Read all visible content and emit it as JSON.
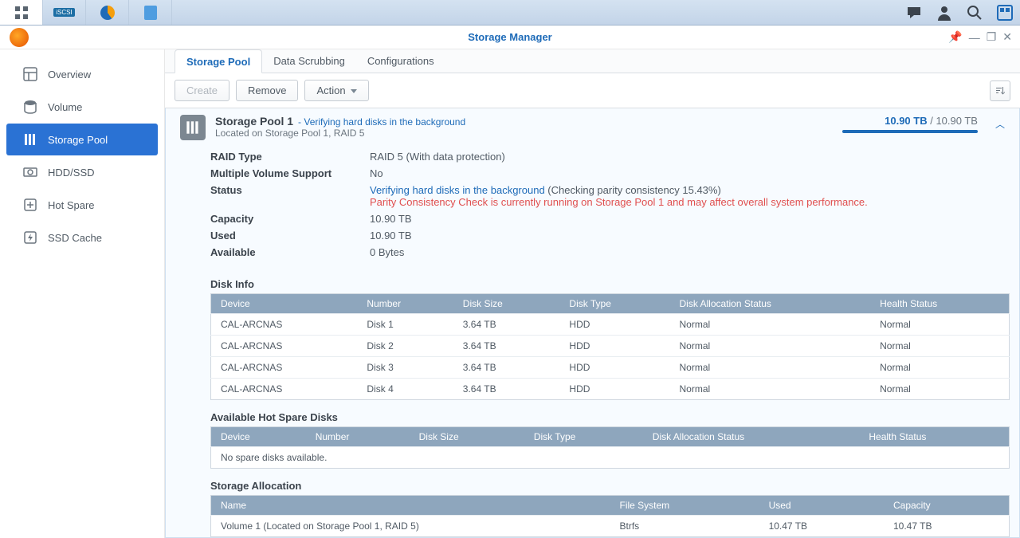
{
  "window": {
    "title": "Storage Manager"
  },
  "sidebar": {
    "items": [
      {
        "label": "Overview"
      },
      {
        "label": "Volume"
      },
      {
        "label": "Storage Pool"
      },
      {
        "label": "HDD/SSD"
      },
      {
        "label": "Hot Spare"
      },
      {
        "label": "SSD Cache"
      }
    ]
  },
  "tabs": {
    "items": [
      {
        "label": "Storage Pool"
      },
      {
        "label": "Data Scrubbing"
      },
      {
        "label": "Configurations"
      }
    ]
  },
  "toolbar": {
    "create": "Create",
    "remove": "Remove",
    "action": "Action"
  },
  "pool": {
    "name": "Storage Pool 1",
    "status_inline": "- Verifying hard disks in the background",
    "location": "Located on Storage Pool 1, RAID 5",
    "capacity_used": "10.90 TB",
    "capacity_total": "10.90 TB",
    "capacity_sep": " / ",
    "fields": {
      "raid_type_label": "RAID Type",
      "raid_type_value": "RAID 5 (With data protection)",
      "mv_label": "Multiple Volume Support",
      "mv_value": "No",
      "status_label": "Status",
      "status_value": "Verifying hard disks in the background",
      "status_extra": " (Checking parity consistency 15.43%)",
      "status_warn": "Parity Consistency Check is currently running on Storage Pool 1 and may affect overall system performance.",
      "capacity_label": "Capacity",
      "capacity_value": "10.90 TB",
      "used_label": "Used",
      "used_value": "10.90 TB",
      "avail_label": "Available",
      "avail_value": "0 Bytes"
    }
  },
  "disk_info": {
    "title": "Disk Info",
    "cols": [
      "Device",
      "Number",
      "Disk Size",
      "Disk Type",
      "Disk Allocation Status",
      "Health Status"
    ],
    "rows": [
      {
        "device": "CAL-ARCNAS",
        "number": "Disk 1",
        "size": "3.64 TB",
        "type": "HDD",
        "alloc": "Normal",
        "health": "Normal"
      },
      {
        "device": "CAL-ARCNAS",
        "number": "Disk 2",
        "size": "3.64 TB",
        "type": "HDD",
        "alloc": "Normal",
        "health": "Normal"
      },
      {
        "device": "CAL-ARCNAS",
        "number": "Disk 3",
        "size": "3.64 TB",
        "type": "HDD",
        "alloc": "Normal",
        "health": "Normal"
      },
      {
        "device": "CAL-ARCNAS",
        "number": "Disk 4",
        "size": "3.64 TB",
        "type": "HDD",
        "alloc": "Normal",
        "health": "Normal"
      }
    ]
  },
  "hotspare": {
    "title": "Available Hot Spare Disks",
    "cols": [
      "Device",
      "Number",
      "Disk Size",
      "Disk Type",
      "Disk Allocation Status",
      "Health Status"
    ],
    "empty": "No spare disks available."
  },
  "allocation": {
    "title": "Storage Allocation",
    "cols": [
      "Name",
      "File System",
      "Used",
      "Capacity"
    ],
    "rows": [
      {
        "name": "Volume 1 (Located on Storage Pool 1, RAID 5)",
        "fs": "Btrfs",
        "used": "10.47 TB",
        "capacity": "10.47 TB"
      }
    ]
  }
}
